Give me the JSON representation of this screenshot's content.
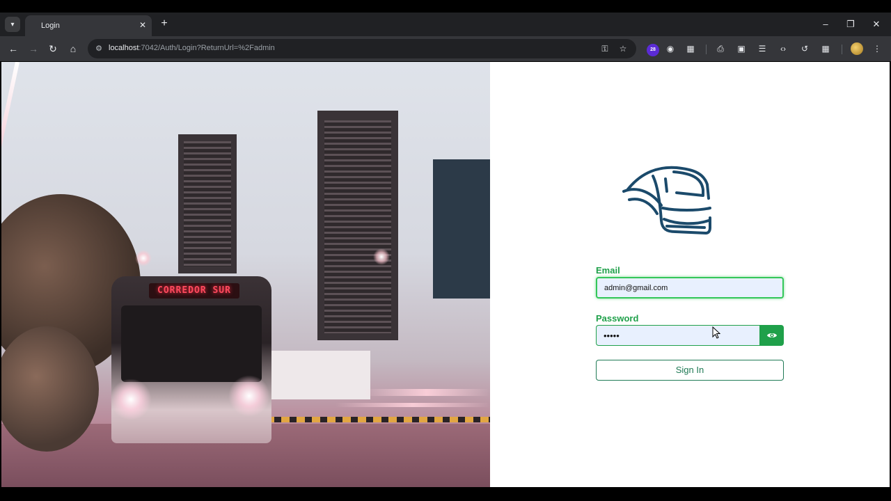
{
  "browser": {
    "tab_title": "Login",
    "url_host": "localhost",
    "url_path": ":7042/Auth/Login?ReturnUrl=%2Fadmin",
    "extension_badge_count": "28",
    "icons": [
      "tab-search-icon",
      "close-icon",
      "plus-icon",
      "minimize-icon",
      "restore-icon",
      "window-close-icon",
      "back-icon",
      "forward-icon",
      "reload-icon",
      "home-icon",
      "site-info-icon",
      "password-key-icon",
      "star-icon",
      "camera-icon",
      "extensions-icon",
      "menu-icon"
    ]
  },
  "hero": {
    "bus_sign_text": "CORREDOR SUR"
  },
  "login": {
    "email_label": "Email",
    "email_value": "admin@gmail.com",
    "password_label": "Password",
    "password_value": "•••••",
    "signin_label": "Sign In"
  },
  "colors": {
    "accent": "#1fa04a",
    "input_bg": "#e8f0fe",
    "logo": "#1b4a6b",
    "chrome_dark": "#202124",
    "chrome_toolbar": "#35363a"
  }
}
